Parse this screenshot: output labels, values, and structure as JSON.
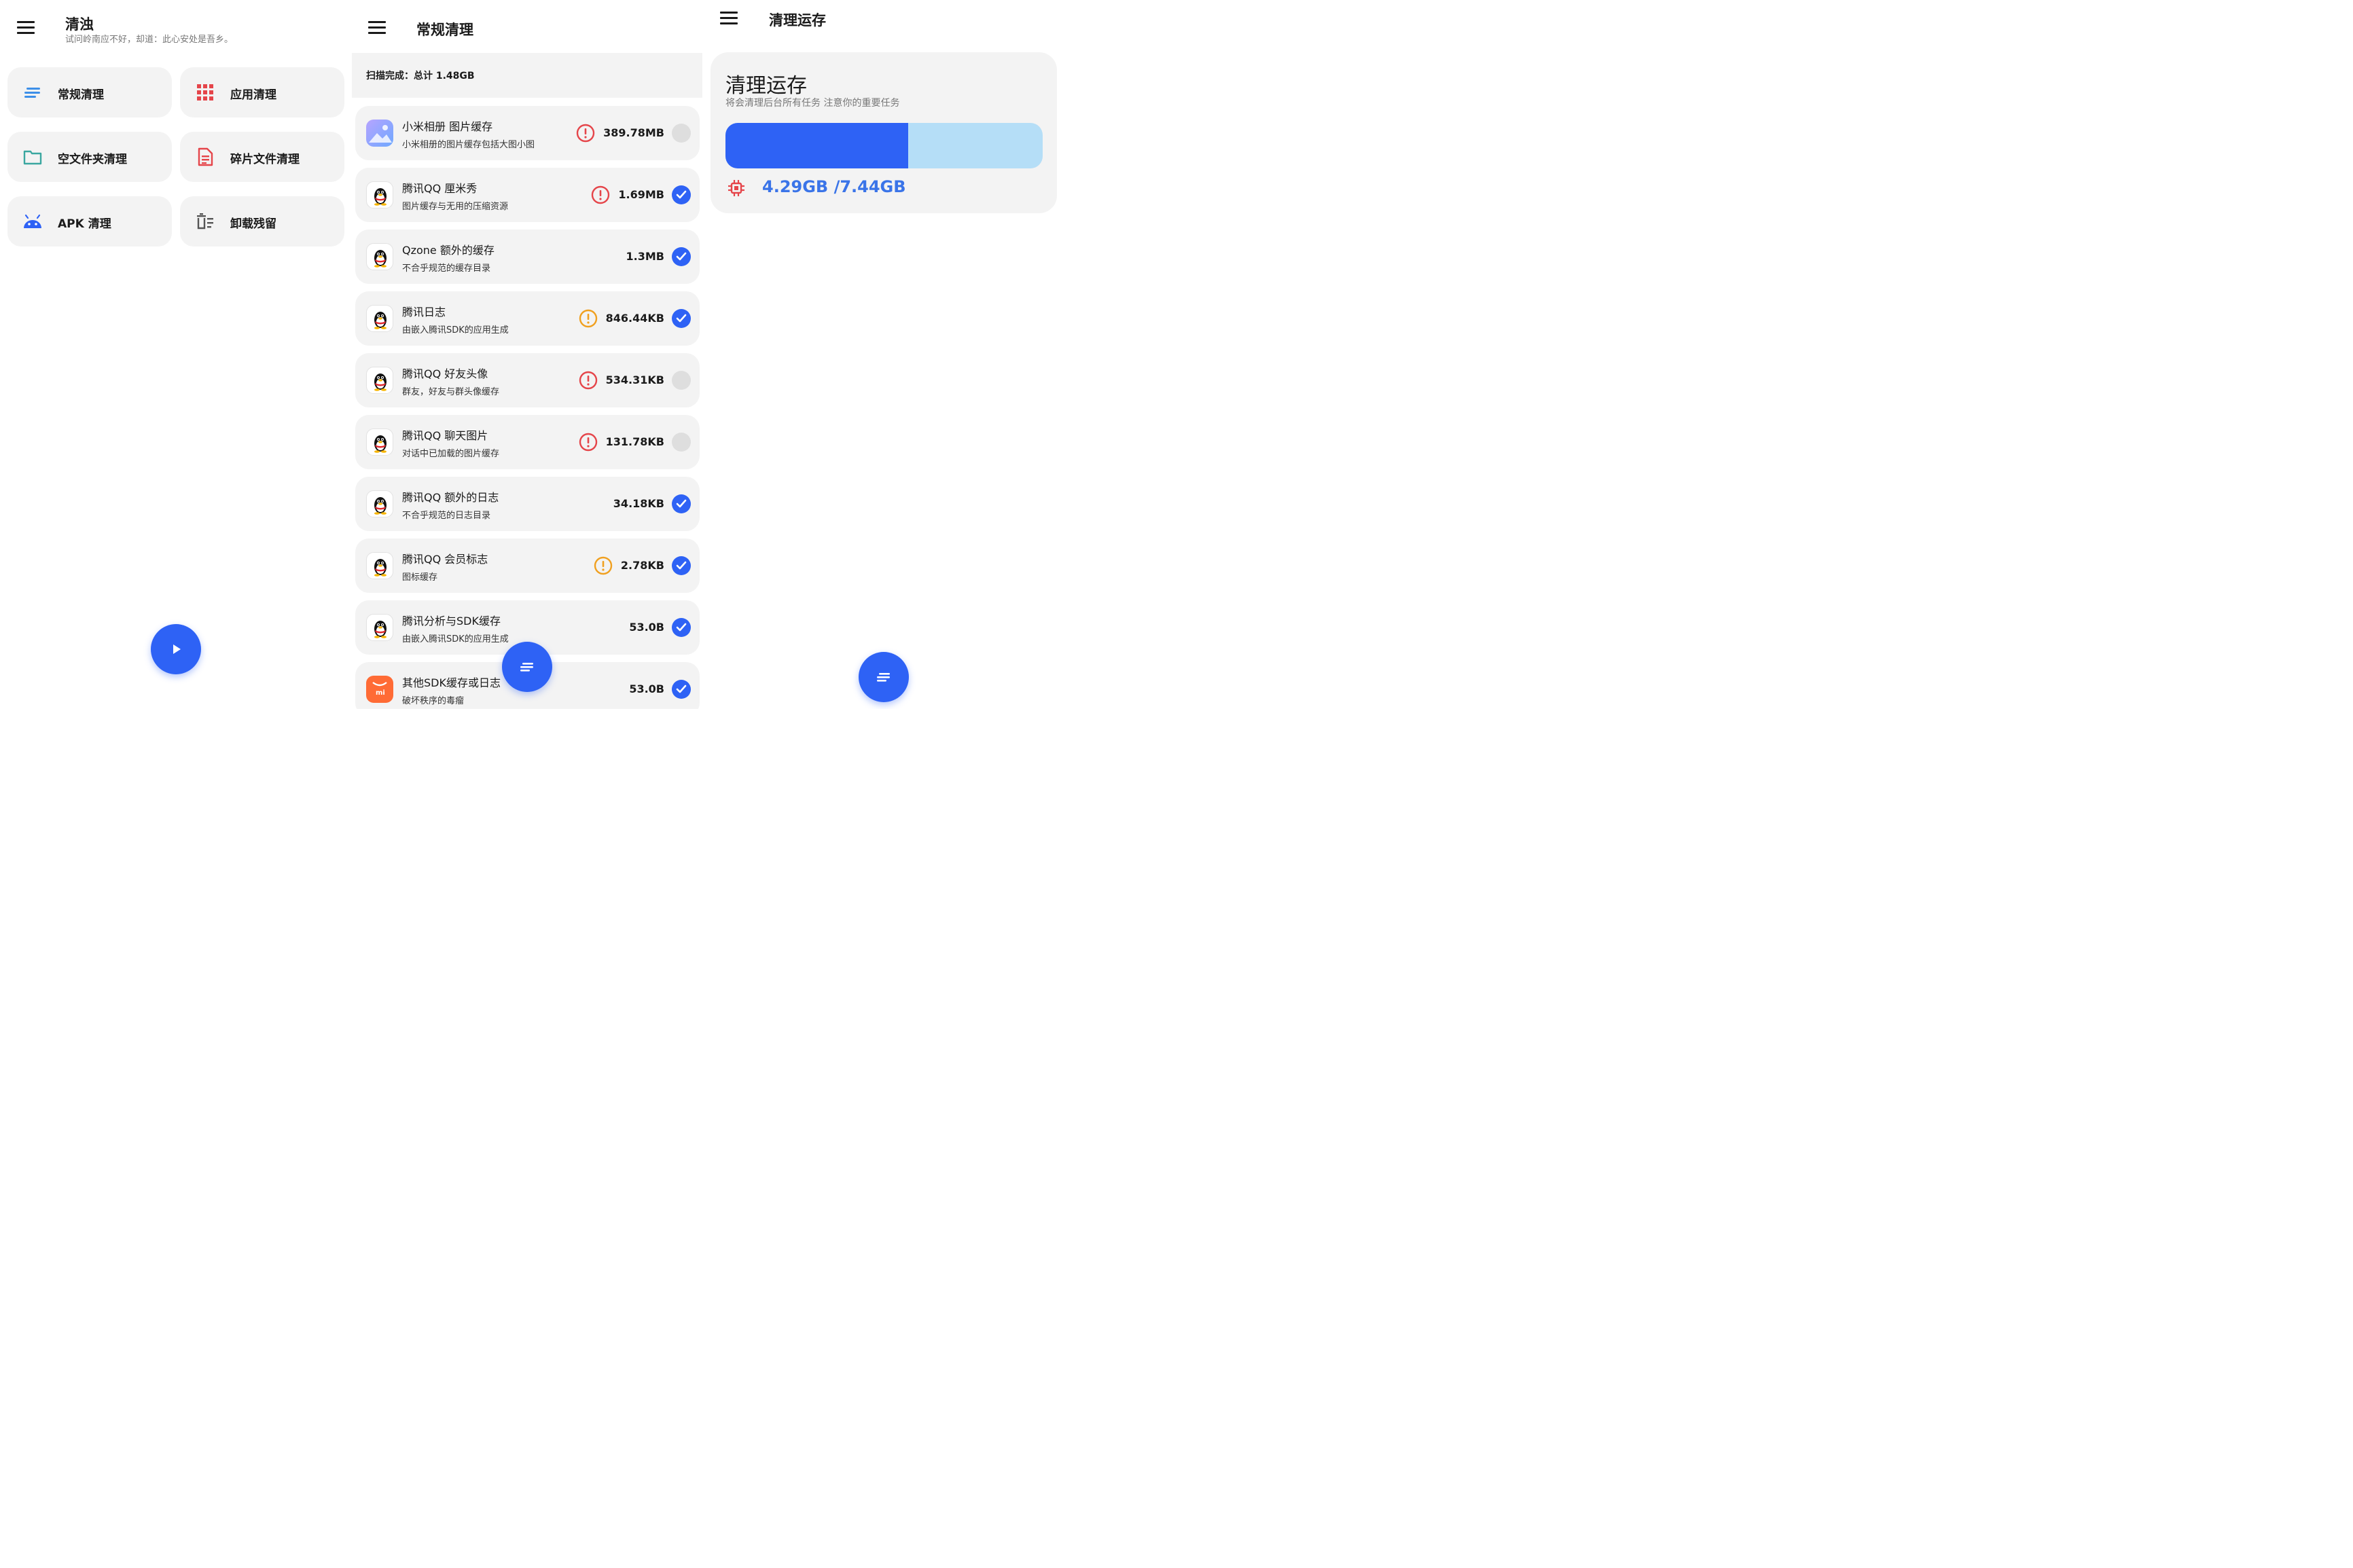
{
  "screen1": {
    "title": "清浊",
    "subtitle": "试问岭南应不好，却道：此心安处是吾乡。",
    "tiles": [
      {
        "label": "常规清理",
        "icon": "lines-icon"
      },
      {
        "label": "应用清理",
        "icon": "grid-icon"
      },
      {
        "label": "空文件夹清理",
        "icon": "folder-icon"
      },
      {
        "label": "碎片文件清理",
        "icon": "document-icon"
      },
      {
        "label": "APK 清理",
        "icon": "android-icon"
      },
      {
        "label": "卸载残留",
        "icon": "trash-list-icon"
      }
    ],
    "fab_icon": "play-icon"
  },
  "screen2": {
    "title": "常规清理",
    "scan_status": "扫描完成：总计 1.48GB",
    "items": [
      {
        "name": "小米相册 图片缓存",
        "desc": "小米相册的图片缓存包括大图小图",
        "size": "389.78MB",
        "warn": "red",
        "checked": false,
        "app_icon": "gallery-icon"
      },
      {
        "name": "腾讯QQ 厘米秀",
        "desc": "图片缓存与无用的压缩资源",
        "size": "1.69MB",
        "warn": "red",
        "checked": true,
        "app_icon": "qq-icon"
      },
      {
        "name": "Qzone 额外的缓存",
        "desc": "不合乎规范的缓存目录",
        "size": "1.3MB",
        "warn": "none",
        "checked": true,
        "app_icon": "qq-icon"
      },
      {
        "name": "腾讯日志",
        "desc": "由嵌入腾讯SDK的应用生成",
        "size": "846.44KB",
        "warn": "orange",
        "checked": true,
        "app_icon": "qq-icon"
      },
      {
        "name": "腾讯QQ 好友头像",
        "desc": "群友，好友与群头像缓存",
        "size": "534.31KB",
        "warn": "red",
        "checked": false,
        "app_icon": "qq-icon"
      },
      {
        "name": "腾讯QQ 聊天图片",
        "desc": "对话中已加载的图片缓存",
        "size": "131.78KB",
        "warn": "red",
        "checked": false,
        "app_icon": "qq-icon"
      },
      {
        "name": "腾讯QQ 额外的日志",
        "desc": "不合乎规范的日志目录",
        "size": "34.18KB",
        "warn": "none",
        "checked": true,
        "app_icon": "qq-icon"
      },
      {
        "name": "腾讯QQ 会员标志",
        "desc": "图标缓存",
        "size": "2.78KB",
        "warn": "orange",
        "checked": true,
        "app_icon": "qq-icon"
      },
      {
        "name": "腾讯分析与SDK缓存",
        "desc": "由嵌入腾讯SDK的应用生成",
        "size": "53.0B",
        "warn": "none",
        "checked": true,
        "app_icon": "qq-icon"
      },
      {
        "name": "其他SDK缓存或日志",
        "desc": "破坏秩序的毒瘤",
        "size": "53.0B",
        "warn": "none",
        "checked": true,
        "app_icon": "mi-store-icon",
        "app_icon_text": "mi"
      }
    ],
    "fab_icon": "lines-icon"
  },
  "screen3": {
    "title": "清理运存",
    "card_title": "清理运存",
    "card_note": "将会清理后台所有任务 注意你的重要任务",
    "memory_text": "4.29GB /7.44GB",
    "memory_used_fraction": 0.577,
    "chip_icon": "chip-icon",
    "fab_icon": "lines-icon"
  },
  "colors": {
    "accent": "#2e62f5",
    "bar_bg": "#b5def7",
    "warn_red": "#e5454a",
    "warn_orange": "#f0a020",
    "card_bg": "#f3f3f3"
  }
}
